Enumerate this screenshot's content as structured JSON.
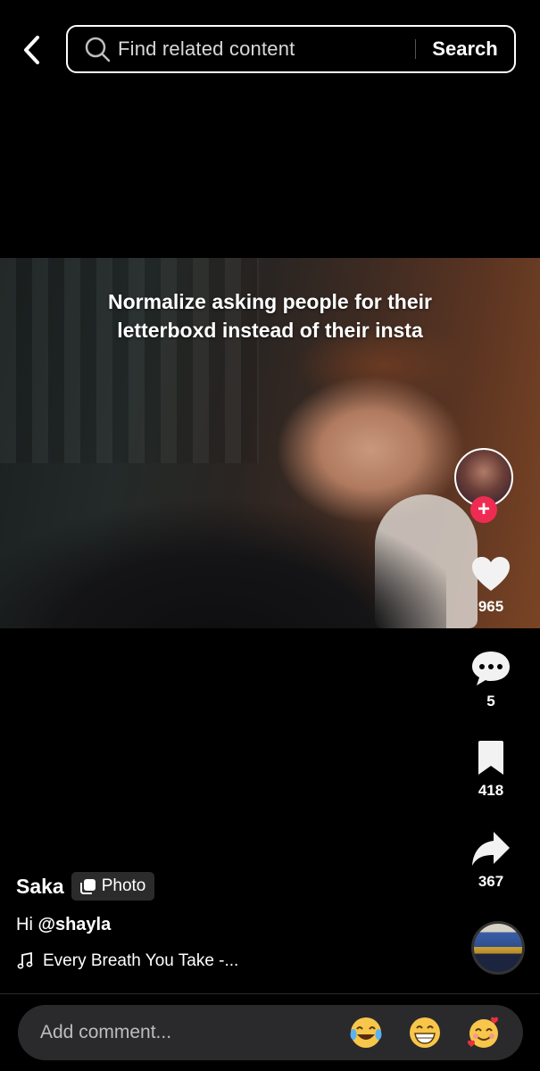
{
  "search": {
    "placeholder": "Find related content",
    "button_label": "Search"
  },
  "post": {
    "caption_lines": [
      "Normalize asking people for their",
      "letterboxd instead of their insta"
    ],
    "author": "Saka",
    "badge_label": "Photo",
    "description_prefix": "Hi ",
    "mention": "@shayla",
    "music": "Every Breath You Take -..."
  },
  "actions": {
    "likes": "965",
    "comments": "5",
    "saves": "418",
    "shares": "367",
    "follow_symbol": "+"
  },
  "comment_bar": {
    "placeholder": "Add comment...",
    "emojis": [
      {
        "name": "face-with-tears-of-joy",
        "glyph": "😂"
      },
      {
        "name": "grinning-face",
        "glyph": "😁"
      },
      {
        "name": "smiling-face-with-hearts",
        "glyph": "🥰"
      }
    ]
  },
  "colors": {
    "background": "#000000",
    "follow_red": "#ee2c53",
    "comment_bar": "#2a2a2c"
  },
  "icons": [
    "back-arrow-icon",
    "search-icon",
    "heart-icon",
    "comment-icon",
    "bookmark-icon",
    "share-icon",
    "photo-icon",
    "music-note-icon"
  ]
}
